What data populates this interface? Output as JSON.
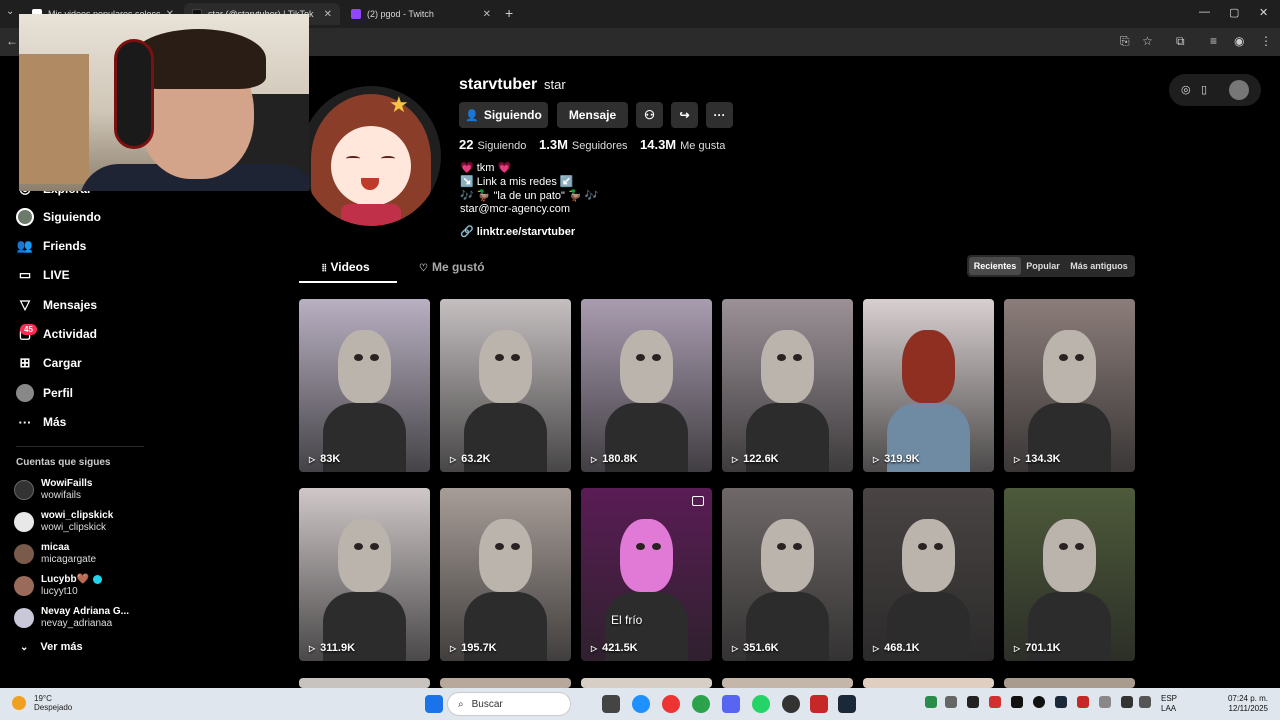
{
  "browser": {
    "tabs": [
      {
        "title": "Mis videos populares seleccio...",
        "active": false,
        "favicon_color": "#ffffff"
      },
      {
        "title": "star (@starvtuber) | TikTok",
        "active": true,
        "favicon_color": "#111111"
      },
      {
        "title": "(2) pgod - Twitch",
        "active": false,
        "favicon_color": "#9146ff"
      }
    ],
    "new_tab": "+",
    "window_controls": [
      "—",
      "▢",
      "✕"
    ]
  },
  "sidebar": {
    "items": [
      {
        "label": "Explorar",
        "icon": "compass-icon"
      },
      {
        "label": "Siguiendo",
        "icon": "following-avatar-icon"
      },
      {
        "label": "Friends",
        "icon": "friends-icon"
      },
      {
        "label": "LIVE",
        "icon": "live-icon"
      },
      {
        "label": "Mensajes",
        "icon": "send-icon"
      },
      {
        "label": "Actividad",
        "icon": "activity-icon"
      },
      {
        "label": "Cargar",
        "icon": "upload-icon"
      },
      {
        "label": "Perfil",
        "icon": "profile-icon"
      },
      {
        "label": "Más",
        "icon": "more-icon"
      }
    ],
    "activity_badge": "45",
    "following_header": "Cuentas que sigues",
    "following": [
      {
        "name": "WowiFaills",
        "username": "wowifails",
        "verified": false,
        "avatar_color": "#333333"
      },
      {
        "name": "wowi_clipskick",
        "username": "wowi_clipskick",
        "verified": false,
        "avatar_color": "#e8e8e8"
      },
      {
        "name": "micaa",
        "username": "micagargate",
        "verified": false,
        "avatar_color": "#7a5a4a"
      },
      {
        "name": "Lucybb🤎",
        "username": "lucyyt10",
        "verified": true,
        "avatar_color": "#9a6a5a"
      },
      {
        "name": "Nevay Adriana G...",
        "username": "nevay_adrianaa",
        "verified": false,
        "avatar_color": "#c8c8d8"
      }
    ],
    "see_more": "Ver más"
  },
  "profile": {
    "username": "starvtuber",
    "nickname": "star",
    "buttons": {
      "following": "Siguiendo",
      "message": "Mensaje"
    },
    "stats": {
      "following_count": "22",
      "following_label": "Siguiendo",
      "followers_count": "1.3M",
      "followers_label": "Seguidores",
      "likes_count": "14.3M",
      "likes_label": "Me gusta"
    },
    "bio": [
      "💗 tkm 💗",
      "↘️ Link a mis redes ↙️",
      "🎶 🦆 \"la de un pato\" 🦆 🎶",
      "star@mcr-agency.com"
    ],
    "link": "linktr.ee/starvtuber"
  },
  "tabs": {
    "videos": "Videos",
    "liked": "Me gustó"
  },
  "sort": {
    "options": [
      "Recientes",
      "Popular",
      "Más antiguos"
    ],
    "selected": "Recientes"
  },
  "videos": [
    {
      "views": "83K",
      "caption": "",
      "bg": "#b9b0c2"
    },
    {
      "views": "63.2K",
      "caption": "",
      "bg": "#c5bfc0"
    },
    {
      "views": "180.8K",
      "caption": "",
      "bg": "#a99cb0"
    },
    {
      "views": "122.6K",
      "caption": "",
      "bg": "#9b9197"
    },
    {
      "views": "319.9K",
      "caption": "",
      "bg": "#d8cfd0"
    },
    {
      "views": "134.3K",
      "caption": "",
      "bg": "#8b7d7a"
    },
    {
      "views": "311.9K",
      "caption": "",
      "bg": "#cfc7c8"
    },
    {
      "views": "195.7K",
      "caption": "",
      "bg": "#a79d98"
    },
    {
      "views": "421.5K",
      "caption": "El frío",
      "bg": "#5a1c55"
    },
    {
      "views": "351.6K",
      "caption": "",
      "bg": "#6f6868"
    },
    {
      "views": "468.1K",
      "caption": "",
      "bg": "#4a4444"
    },
    {
      "views": "701.1K",
      "caption": "",
      "bg": "#4d5a3a"
    }
  ],
  "taskbar": {
    "weather_temp": "19°C",
    "weather_desc": "Despejado",
    "search_placeholder": "Buscar",
    "lang1": "ESP",
    "lang2": "LAA",
    "time": "07:24 p. m.",
    "date": "12/11/2025"
  }
}
